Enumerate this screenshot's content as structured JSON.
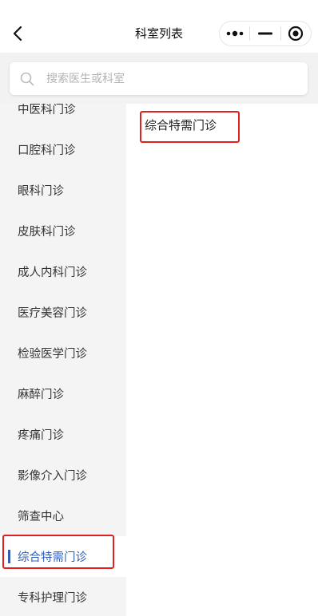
{
  "navbar": {
    "title": "科室列表",
    "back_icon": "chevron-left-icon",
    "more_icon": "more-dots-icon",
    "minimize_icon": "minimize-icon",
    "close_icon": "target-close-icon"
  },
  "search": {
    "placeholder": "搜索医生或科室",
    "icon": "search-icon"
  },
  "sidebar": {
    "items": [
      {
        "label": "中医科门诊"
      },
      {
        "label": "口腔科门诊"
      },
      {
        "label": "眼科门诊"
      },
      {
        "label": "皮肤科门诊"
      },
      {
        "label": "成人内科门诊"
      },
      {
        "label": "医疗美容门诊"
      },
      {
        "label": "检验医学门诊"
      },
      {
        "label": "麻醉门诊"
      },
      {
        "label": "疼痛门诊"
      },
      {
        "label": "影像介入门诊"
      },
      {
        "label": "筛查中心"
      },
      {
        "label": "综合特需门诊",
        "active": true
      },
      {
        "label": "专科护理门诊"
      }
    ],
    "active_color": "#2f5fb8"
  },
  "content": {
    "departments": [
      {
        "label": "综合特需门诊"
      }
    ]
  },
  "colors": {
    "highlight_border": "#e02020",
    "sidebar_bg": "#f4f4f4"
  }
}
